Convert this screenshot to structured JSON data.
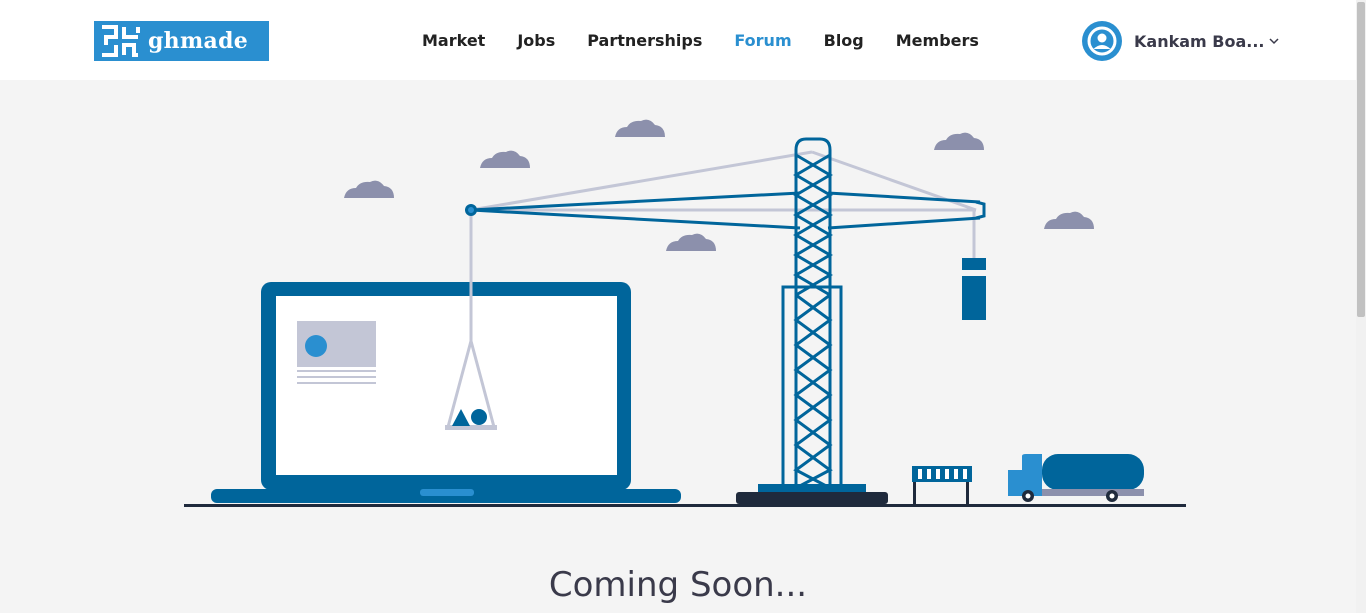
{
  "brand": {
    "logo_text": "ghmade",
    "accent": "#2a8fd0"
  },
  "nav": {
    "items": [
      {
        "label": "Market",
        "active": false
      },
      {
        "label": "Jobs",
        "active": false
      },
      {
        "label": "Partnerships",
        "active": false
      },
      {
        "label": "Forum",
        "active": true
      },
      {
        "label": "Blog",
        "active": false
      },
      {
        "label": "Members",
        "active": false
      }
    ]
  },
  "user": {
    "name": "Kankam Boa...",
    "avatar_icon": "user-circle-icon",
    "menu_icon": "chevron-down-icon"
  },
  "main": {
    "heading": "Coming Soon..."
  },
  "illustration": {
    "description_icon": "under-construction-illustration",
    "colors": {
      "primary": "#00659b",
      "light": "#2a8fd0",
      "cloud": "#8c90ac",
      "cable": "#c3c6d6",
      "ground": "#1f2a3c"
    }
  }
}
